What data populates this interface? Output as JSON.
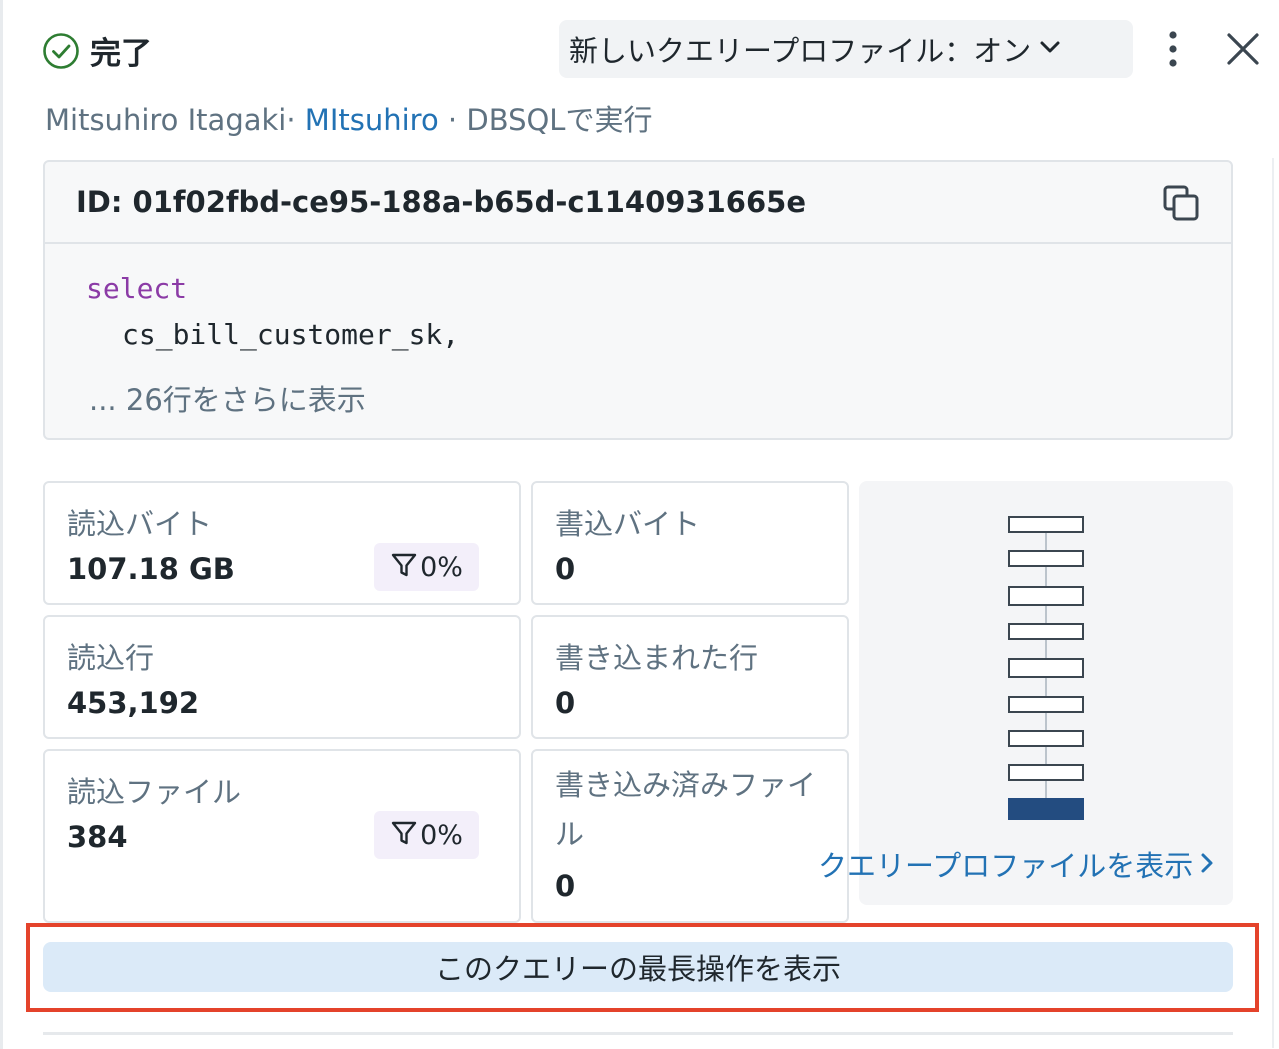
{
  "header": {
    "status": "完了",
    "profile_toggle": "新しいクエリープロファイル：オン",
    "meta": {
      "user": "Mitsuhiro Itagaki",
      "separator1": "· ",
      "workspace": "MItsuhiro",
      "separator2": " · ",
      "engine": "DBSQLで実行"
    }
  },
  "query": {
    "id": "ID: 01f02fbd-ce95-188a-b65d-c1140931665e",
    "code_keyword": "select",
    "code_line2": "cs_bill_customer_sk,",
    "show_more": "... 26行をさらに表示"
  },
  "metrics": {
    "bytes_read": {
      "label": "読込バイト",
      "value": "107.18 GB",
      "pruned": "0%"
    },
    "bytes_written": {
      "label": "書込バイト",
      "value": "0"
    },
    "rows_read": {
      "label": "読込行",
      "value": "453,192"
    },
    "rows_written": {
      "label": "書き込まれた行",
      "value": "0"
    },
    "files_read": {
      "label": "読込ファイル",
      "value": "384",
      "pruned": "0%"
    },
    "files_written": {
      "label": "書き込み済みファイル",
      "value": "0"
    }
  },
  "profile_preview": {
    "link": "クエリープロファイルを表示"
  },
  "longest_operation_button": "このクエリーの最長操作を表示",
  "colors": {
    "success": "#2e7d32",
    "link": "#2272b4",
    "highlight_border": "#e4432b",
    "button_bg": "#dbeaf8",
    "profile_node_active": "#234c80"
  },
  "icons": [
    "check-circle-icon",
    "chevron-down-icon",
    "kebab-menu-icon",
    "close-icon",
    "copy-icon",
    "filter-icon",
    "chevron-right-icon"
  ]
}
